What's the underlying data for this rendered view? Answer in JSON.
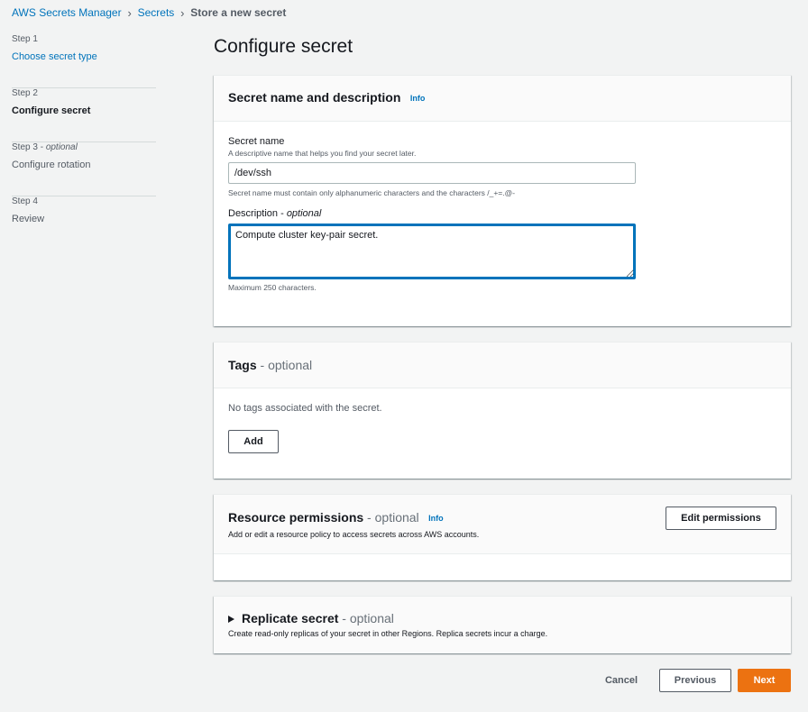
{
  "breadcrumb": {
    "items": [
      "AWS Secrets Manager",
      "Secrets",
      "Store a new secret"
    ]
  },
  "steps": [
    {
      "num": "Step 1",
      "label": "Choose secret type"
    },
    {
      "num": "Step 2",
      "label": "Configure secret"
    },
    {
      "num": "Step 3",
      "num_opt": "optional",
      "label": "Configure rotation"
    },
    {
      "num": "Step 4",
      "label": "Review"
    }
  ],
  "page_title": "Configure secret",
  "name_panel": {
    "title": "Secret name and description",
    "info": "Info",
    "name_label": "Secret name",
    "name_desc": "A descriptive name that helps you find your secret later.",
    "name_value": "/dev/ssh",
    "name_constraint": "Secret name must contain only alphanumeric characters and the characters /_+=.@-",
    "desc_label": "Description",
    "desc_opt": "optional",
    "desc_value": "Compute cluster key-pair secret.",
    "desc_constraint": "Maximum 250 characters."
  },
  "tags_panel": {
    "title": "Tags",
    "optional": "optional",
    "empty_text": "No tags associated with the secret.",
    "add_label": "Add"
  },
  "permissions_panel": {
    "title": "Resource permissions",
    "optional": "optional",
    "info": "Info",
    "desc": "Add or edit a resource policy to access secrets across AWS accounts.",
    "edit_label": "Edit permissions"
  },
  "replicate_panel": {
    "title": "Replicate secret",
    "optional": "optional",
    "desc": "Create read-only replicas of your secret in other Regions. Replica secrets incur a charge."
  },
  "footer": {
    "cancel_label": "Cancel",
    "previous_label": "Previous",
    "next_label": "Next"
  },
  "colors": {
    "accent": "#ec7211",
    "link": "#0073bb",
    "background": "#f2f3f3"
  }
}
